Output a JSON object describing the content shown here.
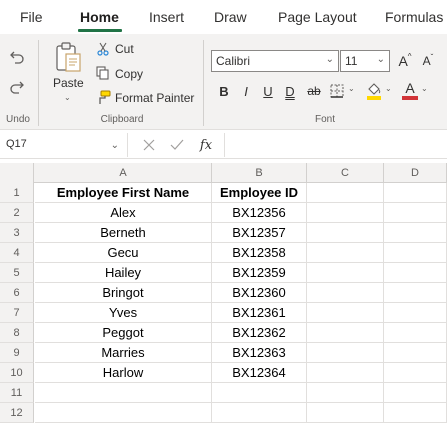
{
  "tabs": [
    {
      "label": "File",
      "active": false
    },
    {
      "label": "Home",
      "active": true
    },
    {
      "label": "Insert",
      "active": false
    },
    {
      "label": "Draw",
      "active": false
    },
    {
      "label": "Page Layout",
      "active": false
    },
    {
      "label": "Formulas",
      "active": false
    }
  ],
  "ribbon": {
    "undo_group_label": "Undo",
    "clipboard": {
      "paste_label": "Paste",
      "cut_label": "Cut",
      "copy_label": "Copy",
      "format_painter_label": "Format Painter",
      "group_label": "Clipboard"
    },
    "font": {
      "font_name": "Calibri",
      "font_size": "11",
      "bold": "B",
      "italic": "I",
      "underline": "U",
      "double_underline": "D",
      "strikethrough": "ab",
      "font_color_letter": "A",
      "group_label": "Font"
    },
    "colors": {
      "accent_green": "#217346",
      "highlight_yellow": "#ffd800",
      "font_red": "#d13438"
    }
  },
  "formula_bar": {
    "name_box": "Q17",
    "fx_label": "fx",
    "formula": ""
  },
  "sheet": {
    "columns": [
      "A",
      "B",
      "C",
      "D"
    ],
    "rows": [
      {
        "num": "1",
        "a": "Employee First Name",
        "b": "Employee ID",
        "header": true
      },
      {
        "num": "2",
        "a": "Alex",
        "b": "BX12356"
      },
      {
        "num": "3",
        "a": "Berneth",
        "b": "BX12357"
      },
      {
        "num": "4",
        "a": "Gecu",
        "b": "BX12358"
      },
      {
        "num": "5",
        "a": "Hailey",
        "b": "BX12359"
      },
      {
        "num": "6",
        "a": "Bringot",
        "b": "BX12360"
      },
      {
        "num": "7",
        "a": "Yves",
        "b": "BX12361"
      },
      {
        "num": "8",
        "a": "Peggot",
        "b": "BX12362"
      },
      {
        "num": "9",
        "a": "Marries",
        "b": "BX12363"
      },
      {
        "num": "10",
        "a": "Harlow",
        "b": "BX12364"
      },
      {
        "num": "11",
        "a": "",
        "b": ""
      },
      {
        "num": "12",
        "a": "",
        "b": ""
      }
    ]
  }
}
